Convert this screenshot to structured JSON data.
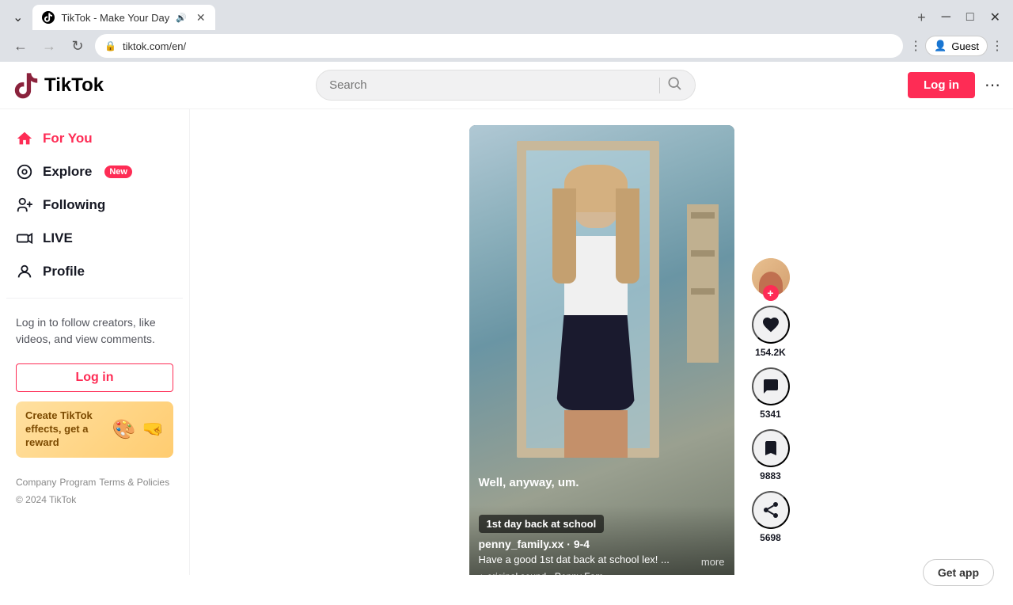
{
  "browser": {
    "tabs": [
      {
        "title": "TikTok - Make Your Day",
        "url": "tiktok.com/en/",
        "active": true
      }
    ],
    "address": "tiktok.com/en/",
    "guest_label": "Guest"
  },
  "header": {
    "logo_text": "TikTok",
    "search_placeholder": "Search",
    "login_label": "Log in"
  },
  "sidebar": {
    "items": [
      {
        "id": "for-you",
        "label": "For You",
        "icon": "🏠",
        "active": true,
        "badge": null
      },
      {
        "id": "explore",
        "label": "Explore",
        "icon": "◎",
        "active": false,
        "badge": "New"
      },
      {
        "id": "following",
        "label": "Following",
        "icon": "👤",
        "active": false,
        "badge": null
      },
      {
        "id": "live",
        "label": "LIVE",
        "icon": "📺",
        "active": false,
        "badge": null
      },
      {
        "id": "profile",
        "label": "Profile",
        "icon": "👤",
        "active": false,
        "badge": null
      }
    ],
    "login_prompt": "Log in to follow creators, like videos, and view comments.",
    "login_button": "Log in",
    "promo_text": "Create TikTok effects, get a reward",
    "footer": {
      "links": [
        "Company",
        "Program",
        "Terms & Policies"
      ],
      "copyright": "© 2024 TikTok"
    }
  },
  "video": {
    "username": "penny_family.xx · 9-4",
    "description": "Have a good 1st dat back at school lex! ...   more",
    "sound": "original sound - Penny Fam",
    "caption": "1st day back at school",
    "subtitle": "Well, anyway, um.",
    "more_label": "more"
  },
  "actions": {
    "like_count": "154.2K",
    "comment_count": "5341",
    "bookmark_count": "9883",
    "share_count": "5698"
  },
  "get_app": {
    "label": "Get app"
  }
}
